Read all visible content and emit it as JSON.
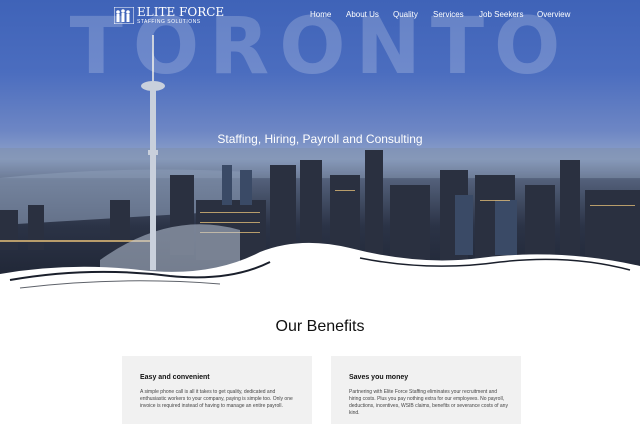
{
  "brand": {
    "name": "ELITE FORCE",
    "subtitle": "STAFFING SOLUTIONS",
    "logo_icon": "people-silhouettes-icon"
  },
  "nav": {
    "items": [
      "Home",
      "About Us",
      "Quality",
      "Services",
      "Job Seekers",
      "Overview"
    ]
  },
  "hero": {
    "watermark": "TORONTO",
    "tagline": "Staffing, Hiring, Payroll and Consulting"
  },
  "benefits": {
    "title": "Our Benefits",
    "cards": [
      {
        "title": "Easy and convenient",
        "text": "A simple phone call is all it takes to get quality, dedicated and enthusiastic workers to your company, paying is simple too. Only one invoice is required instead of having to manage an entire payroll."
      },
      {
        "title": "Saves you money",
        "text": "Partnering with Elite Force Staffing eliminates your recruitment and hiring costs. Plus you pay nothing extra for our employees. No payroll, deductions, incentives, WSIB claims, benefits or severance costs of any kind."
      }
    ]
  },
  "colors": {
    "sky_top": "#3f63b8",
    "city_dark": "#1e2433",
    "card_bg": "#f1f1f1",
    "heading": "#111111"
  }
}
